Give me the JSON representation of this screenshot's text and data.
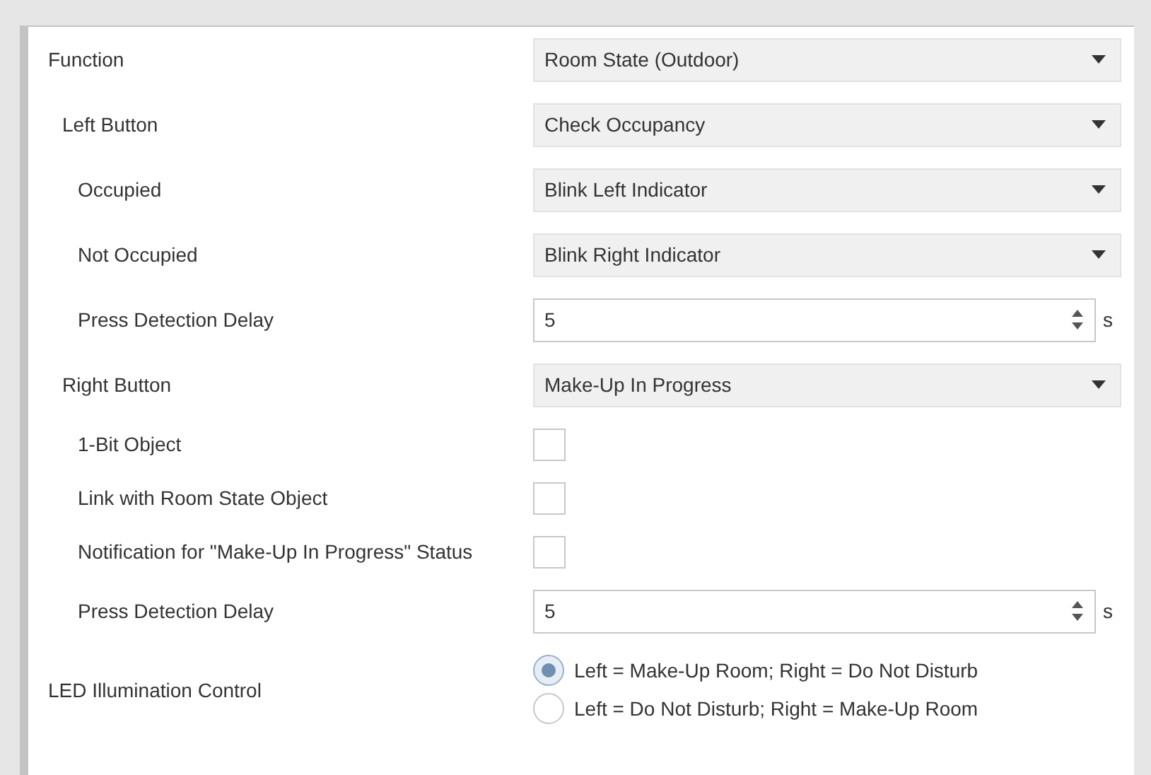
{
  "parameters": [
    {
      "kind": "dropdown",
      "label": "Function",
      "value": "Room State (Outdoor)",
      "children": [
        {
          "kind": "dropdown",
          "label": "Left Button",
          "value": "Check Occupancy",
          "children": [
            {
              "kind": "dropdown",
              "label": "Occupied",
              "value": "Blink Left Indicator"
            },
            {
              "kind": "dropdown",
              "label": "Not Occupied",
              "value": "Blink Right Indicator"
            },
            {
              "kind": "number",
              "label": "Press Detection Delay",
              "value": "5",
              "unit": "s"
            }
          ]
        },
        {
          "kind": "dropdown",
          "label": "Right Button",
          "value": "Make-Up In Progress",
          "children": [
            {
              "kind": "checkbox",
              "label": "1-Bit Object",
              "checked": false
            },
            {
              "kind": "checkbox",
              "label": "Link with Room State Object",
              "checked": false
            },
            {
              "kind": "checkbox",
              "label": "Notification for \"Make-Up In Progress\" Status",
              "checked": false
            },
            {
              "kind": "number",
              "label": "Press Detection Delay",
              "value": "5",
              "unit": "s"
            }
          ]
        }
      ]
    },
    {
      "kind": "radio",
      "label": "LED Illumination Control",
      "options": [
        {
          "label": "Left = Make-Up Room; Right = Do Not Disturb",
          "selected": true
        },
        {
          "label": "Left = Do Not Disturb; Right = Make-Up Room",
          "selected": false
        }
      ]
    }
  ]
}
